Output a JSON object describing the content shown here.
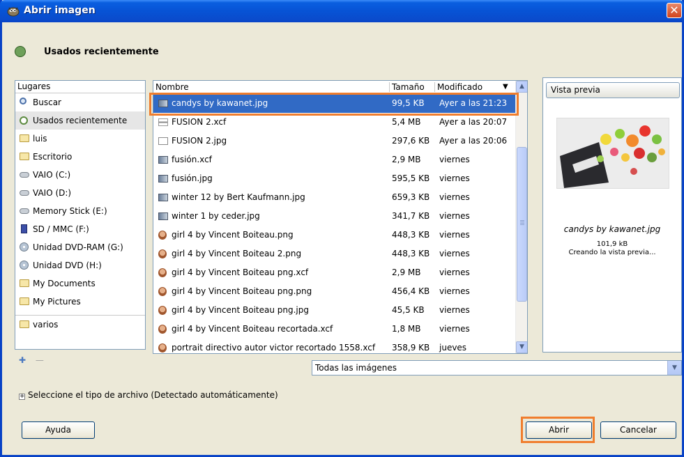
{
  "window": {
    "title": "Abrir imagen",
    "close_glyph": "✕"
  },
  "location": {
    "label": "Usados recientemente",
    "icon": "recent-clock-icon"
  },
  "places": {
    "header": "Lugares",
    "items": [
      {
        "label": "Buscar",
        "icon": "search-icon"
      },
      {
        "label": "Usados recientemente",
        "icon": "recent-clock-icon",
        "selected": true
      },
      {
        "label": "luis",
        "icon": "folder-icon"
      },
      {
        "label": "Escritorio",
        "icon": "folder-icon"
      },
      {
        "label": "VAIO (C:)",
        "icon": "drive-icon"
      },
      {
        "label": "VAIO (D:)",
        "icon": "drive-icon"
      },
      {
        "label": "Memory Stick (E:)",
        "icon": "drive-icon"
      },
      {
        "label": "SD / MMC (F:)",
        "icon": "card-icon"
      },
      {
        "label": "Unidad DVD-RAM (G:)",
        "icon": "disc-icon"
      },
      {
        "label": "Unidad DVD (H:)",
        "icon": "disc-icon"
      },
      {
        "label": "My Documents",
        "icon": "folder-icon"
      },
      {
        "label": "My Pictures",
        "icon": "folder-icon"
      },
      {
        "label": "varios",
        "icon": "folder-icon"
      }
    ],
    "add_glyph": "✚",
    "remove_glyph": "—"
  },
  "files": {
    "columns": {
      "name": "Nombre",
      "size": "Tamaño",
      "modified": "Modificado"
    },
    "sort_glyph": "▼",
    "rows": [
      {
        "name": "candys by kawanet.jpg",
        "size": "99,5 KB",
        "modified": "Ayer a las 21:23",
        "icon": "image-thumb-icon",
        "selected": true
      },
      {
        "name": "FUSION 2.xcf",
        "size": "5,4 MB",
        "modified": "Ayer a las 20:07",
        "icon": "xcf-thumb-icon"
      },
      {
        "name": "FUSION 2.jpg",
        "size": "297,6 KB",
        "modified": "Ayer a las 20:06",
        "icon": "image-file-icon"
      },
      {
        "name": "fusión.xcf",
        "size": "2,9 MB",
        "modified": "viernes",
        "icon": "image-thumb-icon"
      },
      {
        "name": "fusión.jpg",
        "size": "595,5 KB",
        "modified": "viernes",
        "icon": "image-thumb-icon"
      },
      {
        "name": "winter 12 by  Bert Kaufmann.jpg",
        "size": "659,3 KB",
        "modified": "viernes",
        "icon": "image-thumb-icon"
      },
      {
        "name": "winter 1 by ceder.jpg",
        "size": "341,7 KB",
        "modified": "viernes",
        "icon": "image-thumb-icon"
      },
      {
        "name": "girl 4 by Vincent Boiteau.png",
        "size": "448,3 KB",
        "modified": "viernes",
        "icon": "portrait-thumb-icon"
      },
      {
        "name": "girl 4 by Vincent Boiteau 2.png",
        "size": "448,3 KB",
        "modified": "viernes",
        "icon": "portrait-thumb-icon"
      },
      {
        "name": "girl 4 by Vincent Boiteau png.xcf",
        "size": "2,9 MB",
        "modified": "viernes",
        "icon": "portrait-thumb-icon"
      },
      {
        "name": "girl 4 by Vincent Boiteau png.png",
        "size": "456,4 KB",
        "modified": "viernes",
        "icon": "portrait-thumb-icon"
      },
      {
        "name": "girl 4 by Vincent Boiteau png.jpg",
        "size": "45,5 KB",
        "modified": "viernes",
        "icon": "portrait-thumb-icon"
      },
      {
        "name": "girl 4 by Vincent Boiteau recortada.xcf",
        "size": "1,8 MB",
        "modified": "viernes",
        "icon": "portrait-thumb-icon"
      },
      {
        "name": "portrait directivo autor victor recortado 1558.xcf",
        "size": "358,9 KB",
        "modified": "jueves",
        "icon": "portrait-thumb-icon"
      }
    ],
    "scroll_up_glyph": "▲",
    "scroll_down_glyph": "▼"
  },
  "preview": {
    "button_label": "Vista previa",
    "filename": "candys by kawanet.jpg",
    "size": "101,9 kB",
    "status": "Creando la vista previa..."
  },
  "filter": {
    "selected": "Todas las imágenes",
    "arrow_glyph": "▼"
  },
  "file_type": {
    "expander_glyph": "+",
    "label": "Seleccione el tipo de archivo (Detectado automáticamente)"
  },
  "buttons": {
    "help": "Ayuda",
    "open": "Abrir",
    "cancel": "Cancelar"
  },
  "colors": {
    "titlebar": "#0753d5",
    "selection": "#316ac5",
    "highlight": "#f07d2d"
  }
}
